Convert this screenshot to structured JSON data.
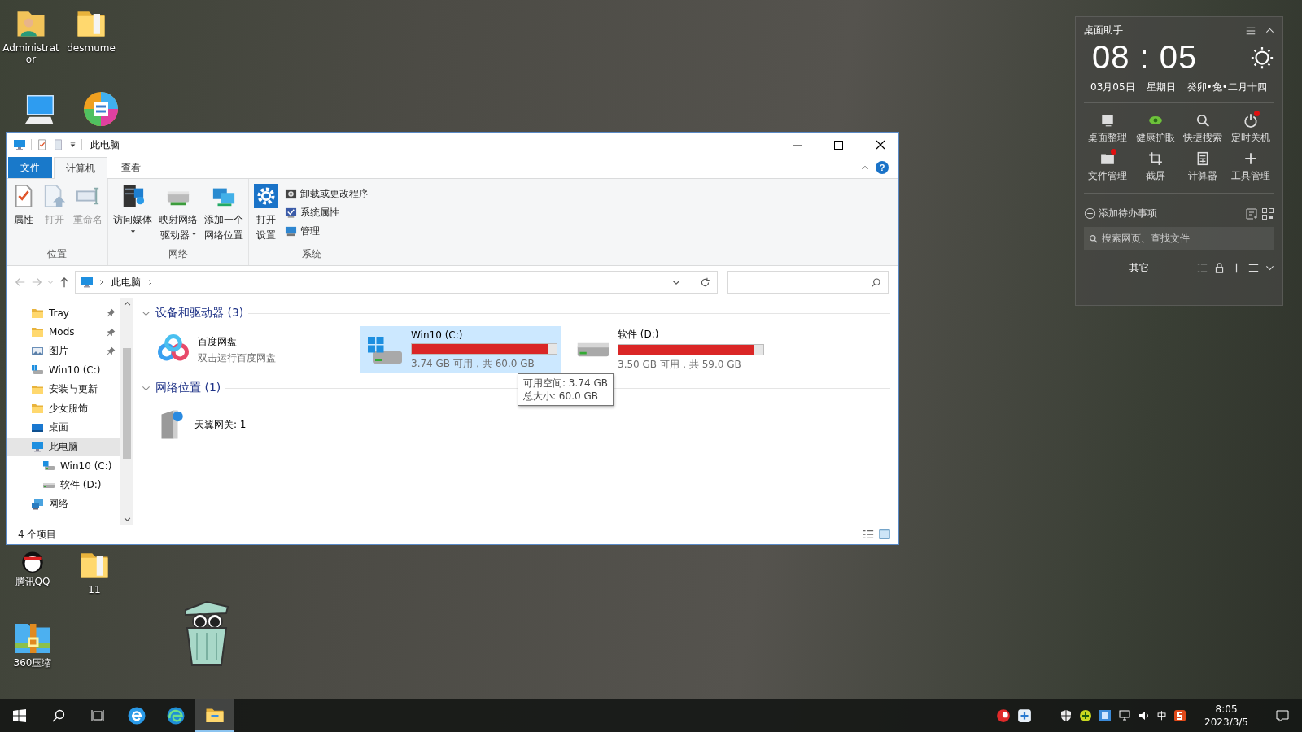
{
  "desktop": {
    "icons": [
      {
        "kind": "user-folder",
        "label": "Administrator"
      },
      {
        "kind": "folder",
        "label": "desmume"
      },
      {
        "kind": "computer"
      },
      {
        "kind": "app"
      },
      {
        "kind": "qq",
        "label": "腾讯QQ"
      },
      {
        "kind": "folder",
        "label": "11"
      },
      {
        "kind": "zip",
        "label": "360压缩"
      }
    ]
  },
  "explorer": {
    "title": "此电脑",
    "ribbon_tabs": [
      {
        "label": "文件",
        "kind": "file",
        "selected": false
      },
      {
        "label": "计算机",
        "kind": "tab",
        "selected": true
      },
      {
        "label": "查看",
        "kind": "tab",
        "selected": false
      }
    ],
    "help": "?",
    "ribbon_groups": [
      {
        "label": "位置",
        "buttons": [
          {
            "kind": "large",
            "lines": [
              "属性"
            ],
            "disabled": false,
            "dropdown": false
          },
          {
            "kind": "large",
            "lines": [
              "打开"
            ],
            "disabled": true,
            "dropdown": false
          },
          {
            "kind": "large",
            "lines": [
              "重命名"
            ],
            "disabled": true,
            "dropdown": false
          }
        ]
      },
      {
        "label": "网络",
        "buttons": [
          {
            "kind": "large",
            "lines": [
              "访问媒体"
            ],
            "disabled": false,
            "dropdown": true
          },
          {
            "kind": "large",
            "lines": [
              "映射网络",
              "驱动器"
            ],
            "disabled": false,
            "dropdown": true
          },
          {
            "kind": "large",
            "lines": [
              "添加一个",
              "网络位置"
            ],
            "disabled": false,
            "dropdown": false
          }
        ]
      },
      {
        "label": "系统",
        "buttons": [
          {
            "kind": "large",
            "lines": [
              "打开",
              "设置"
            ],
            "disabled": false,
            "dropdown": false
          },
          {
            "kind": "small",
            "lines": [
              "卸载或更改程序"
            ],
            "disabled": false,
            "dropdown": false
          },
          {
            "kind": "small",
            "lines": [
              "系统属性"
            ],
            "disabled": false,
            "dropdown": false
          },
          {
            "kind": "small",
            "lines": [
              "管理"
            ],
            "disabled": false,
            "dropdown": false
          }
        ]
      }
    ],
    "address": {
      "path": [
        "此电脑"
      ]
    },
    "nav": [
      {
        "kind": "folder",
        "label": "Tray",
        "pinned": true,
        "selected": false
      },
      {
        "kind": "folder",
        "label": "Mods",
        "pinned": true,
        "selected": false
      },
      {
        "kind": "pictures",
        "label": "图片",
        "pinned": true,
        "selected": false
      },
      {
        "kind": "system-drive",
        "label": "Win10 (C:)",
        "pinned": false,
        "selected": false
      },
      {
        "kind": "folder",
        "label": "安装与更新",
        "pinned": false,
        "selected": false
      },
      {
        "kind": "folder",
        "label": "少女服饰",
        "pinned": false,
        "selected": false
      },
      {
        "kind": "desktop",
        "label": "桌面",
        "pinned": false,
        "selected": false
      },
      {
        "kind": "computer",
        "label": "此电脑",
        "pinned": false,
        "selected": true,
        "children": [
          {
            "kind": "system-drive",
            "label": "Win10 (C:)",
            "pinned": false,
            "selected": false
          },
          {
            "kind": "drive",
            "label": "软件 (D:)",
            "pinned": false,
            "selected": false
          }
        ]
      },
      {
        "kind": "network",
        "label": "网络",
        "pinned": false,
        "selected": false
      }
    ],
    "groups": [
      {
        "title": "设备和驱动器 (3)",
        "expanded": true,
        "items": [
          {
            "kind": "app",
            "name": "百度网盘",
            "subtitle": "双击运行百度网盘",
            "selected": false
          },
          {
            "kind": "system-drive",
            "name": "Win10 (C:)",
            "level": 0.938,
            "detail": "3.74 GB 可用，共 60.0 GB",
            "selected": true
          },
          {
            "kind": "drive",
            "name": "软件 (D:)",
            "level": 0.941,
            "detail": "3.50 GB 可用，共 59.0 GB",
            "selected": false
          }
        ]
      },
      {
        "title": "网络位置 (1)",
        "expanded": true,
        "items": [
          {
            "kind": "router",
            "name": "天翼网关: 1",
            "selected": false
          }
        ]
      }
    ],
    "tooltip": [
      "可用空间: 3.74 GB",
      "总大小: 60.0 GB"
    ],
    "status": "4 个项目"
  },
  "widget": {
    "title": "桌面助手",
    "time": "08 : 05",
    "date": "03月05日",
    "weekday": "星期日",
    "lunar": "癸卯•兔•二月十四",
    "tools": [
      {
        "kind": "desktop",
        "label": "桌面整理",
        "notice": false
      },
      {
        "kind": "eye",
        "label": "健康护眼",
        "notice": false
      },
      {
        "kind": "search",
        "label": "快捷搜索",
        "notice": false
      },
      {
        "kind": "power",
        "label": "定时关机",
        "notice": true
      },
      {
        "kind": "folder",
        "label": "文件管理",
        "notice": true
      },
      {
        "kind": "crop",
        "label": "截屏",
        "notice": false
      },
      {
        "kind": "calculator",
        "label": "计算器",
        "notice": false
      },
      {
        "kind": "plus",
        "label": "工具管理",
        "notice": false
      }
    ],
    "todo": "添加待办事项",
    "search_placeholder": "搜索网页、查找文件",
    "footer": "其它"
  },
  "taskbar": {
    "apps": [
      {
        "kind": "ie",
        "active": false
      },
      {
        "kind": "edge",
        "active": false
      },
      {
        "kind": "explorer",
        "active": true
      }
    ],
    "ime": "中",
    "time": "8:05",
    "date": "2023/3/5"
  }
}
